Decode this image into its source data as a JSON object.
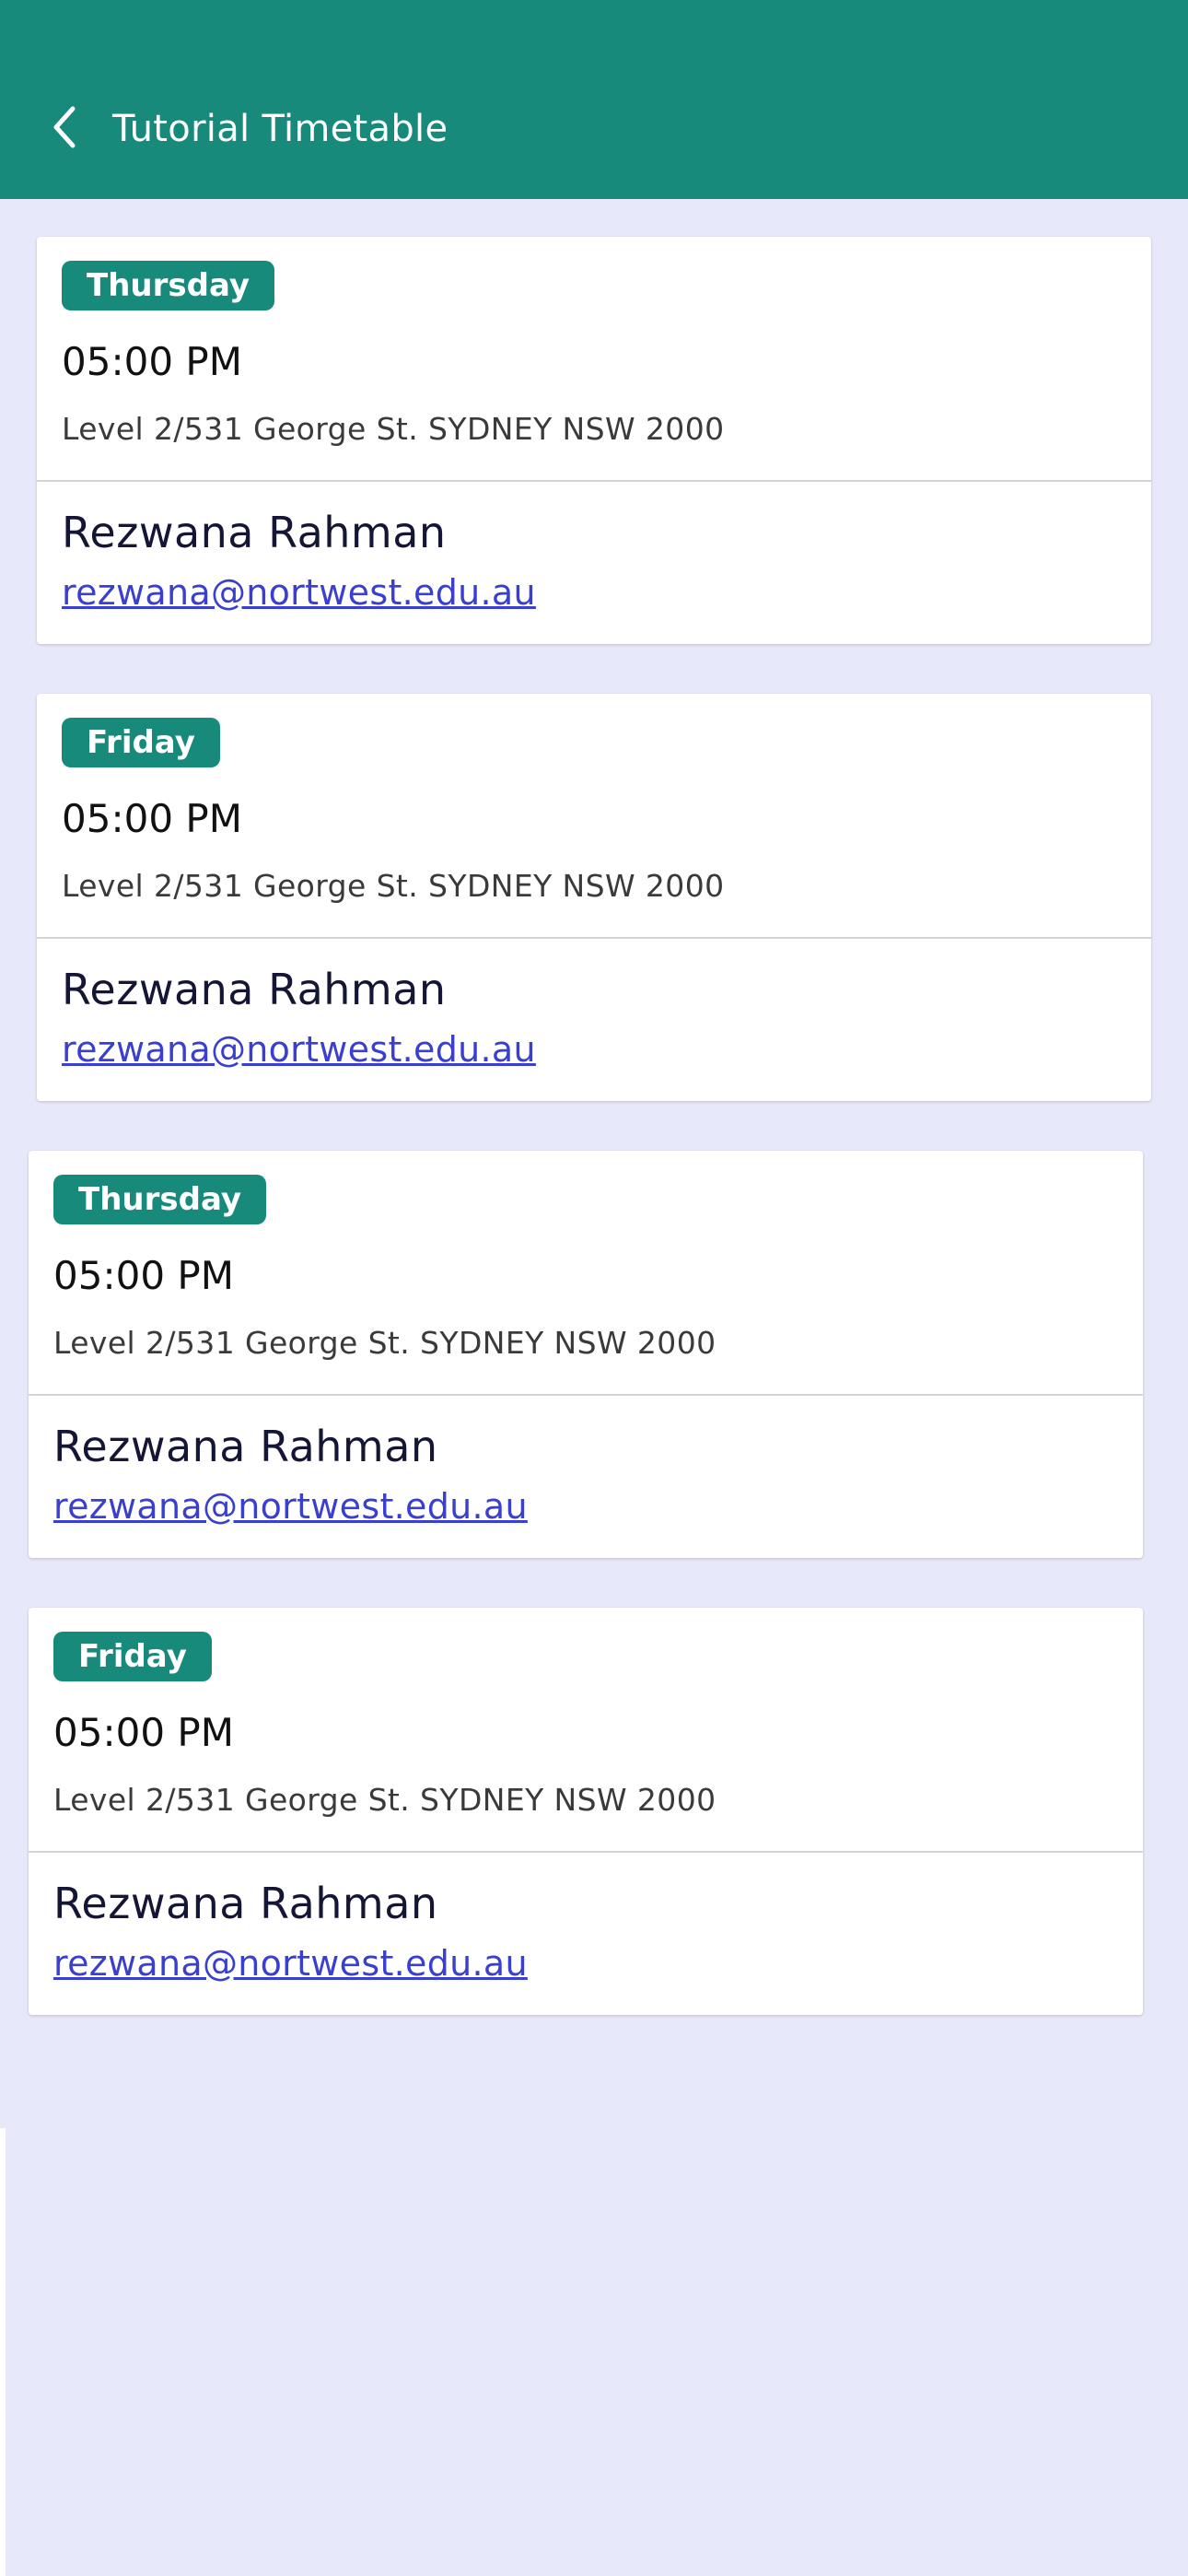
{
  "header": {
    "title": "Tutorial Timetable",
    "back_icon": "chevron-left-icon",
    "background": "#178a7b"
  },
  "colors": {
    "badge": "#178a7b",
    "page_background": "#e8e8fb",
    "link": "#3a3fcf"
  },
  "sessions": [
    {
      "day": "Thursday",
      "time": "05:00 PM",
      "address": "Level 2/531 George St. SYDNEY NSW 2000",
      "tutor_name": "Rezwana Rahman",
      "tutor_email": "rezwana@nortwest.edu.au"
    },
    {
      "day": "Friday",
      "time": "05:00 PM",
      "address": "Level 2/531 George St. SYDNEY NSW 2000",
      "tutor_name": "Rezwana Rahman",
      "tutor_email": "rezwana@nortwest.edu.au"
    },
    {
      "day": "Thursday",
      "time": "05:00 PM",
      "address": "Level 2/531 George St. SYDNEY NSW 2000",
      "tutor_name": "Rezwana Rahman",
      "tutor_email": "rezwana@nortwest.edu.au"
    },
    {
      "day": "Friday",
      "time": "05:00 PM",
      "address": "Level 2/531 George St. SYDNEY NSW 2000",
      "tutor_name": "Rezwana Rahman",
      "tutor_email": "rezwana@nortwest.edu.au"
    }
  ]
}
